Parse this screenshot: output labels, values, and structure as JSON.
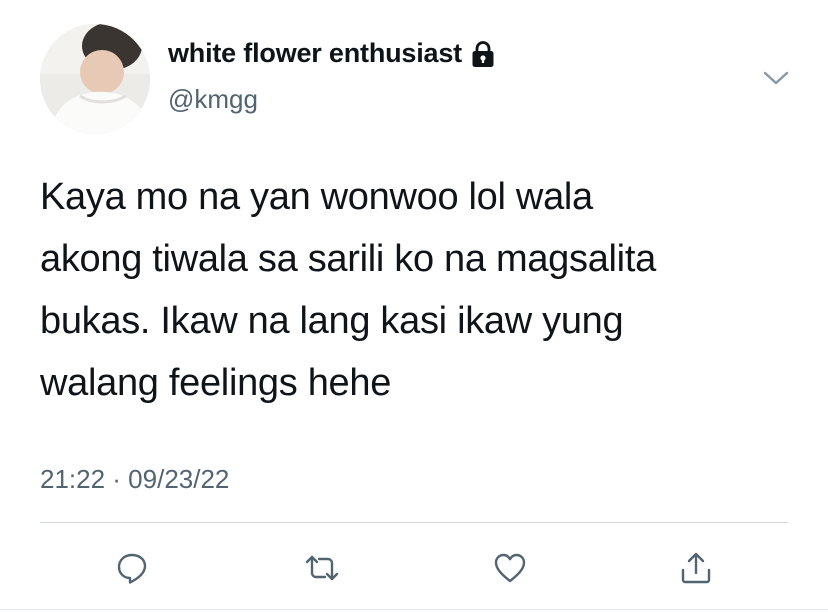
{
  "author": {
    "display_name": "white flower enthusiast",
    "handle": "@kmgg",
    "protected_icon": "lock-icon",
    "avatar": "profile-photo"
  },
  "tweet": {
    "text_lines": [
      "Kaya mo na yan wonwoo lol wala",
      "akong tiwala sa sarili ko na magsalita",
      "bukas. Ikaw na lang kasi ikaw yung",
      "walang feelings hehe"
    ],
    "timestamp": "21:22 · 09/23/22"
  },
  "header": {
    "more_icon": "chevron-down-icon"
  },
  "actions": [
    {
      "name": "reply",
      "icon": "reply-icon"
    },
    {
      "name": "retweet",
      "icon": "retweet-icon"
    },
    {
      "name": "like",
      "icon": "heart-icon"
    },
    {
      "name": "share",
      "icon": "share-icon"
    }
  ],
  "colors": {
    "text_primary": "#0f1419",
    "text_secondary": "#536471",
    "icon_color": "#536471",
    "divider": "#cfd9de",
    "background": "#ffffff"
  }
}
